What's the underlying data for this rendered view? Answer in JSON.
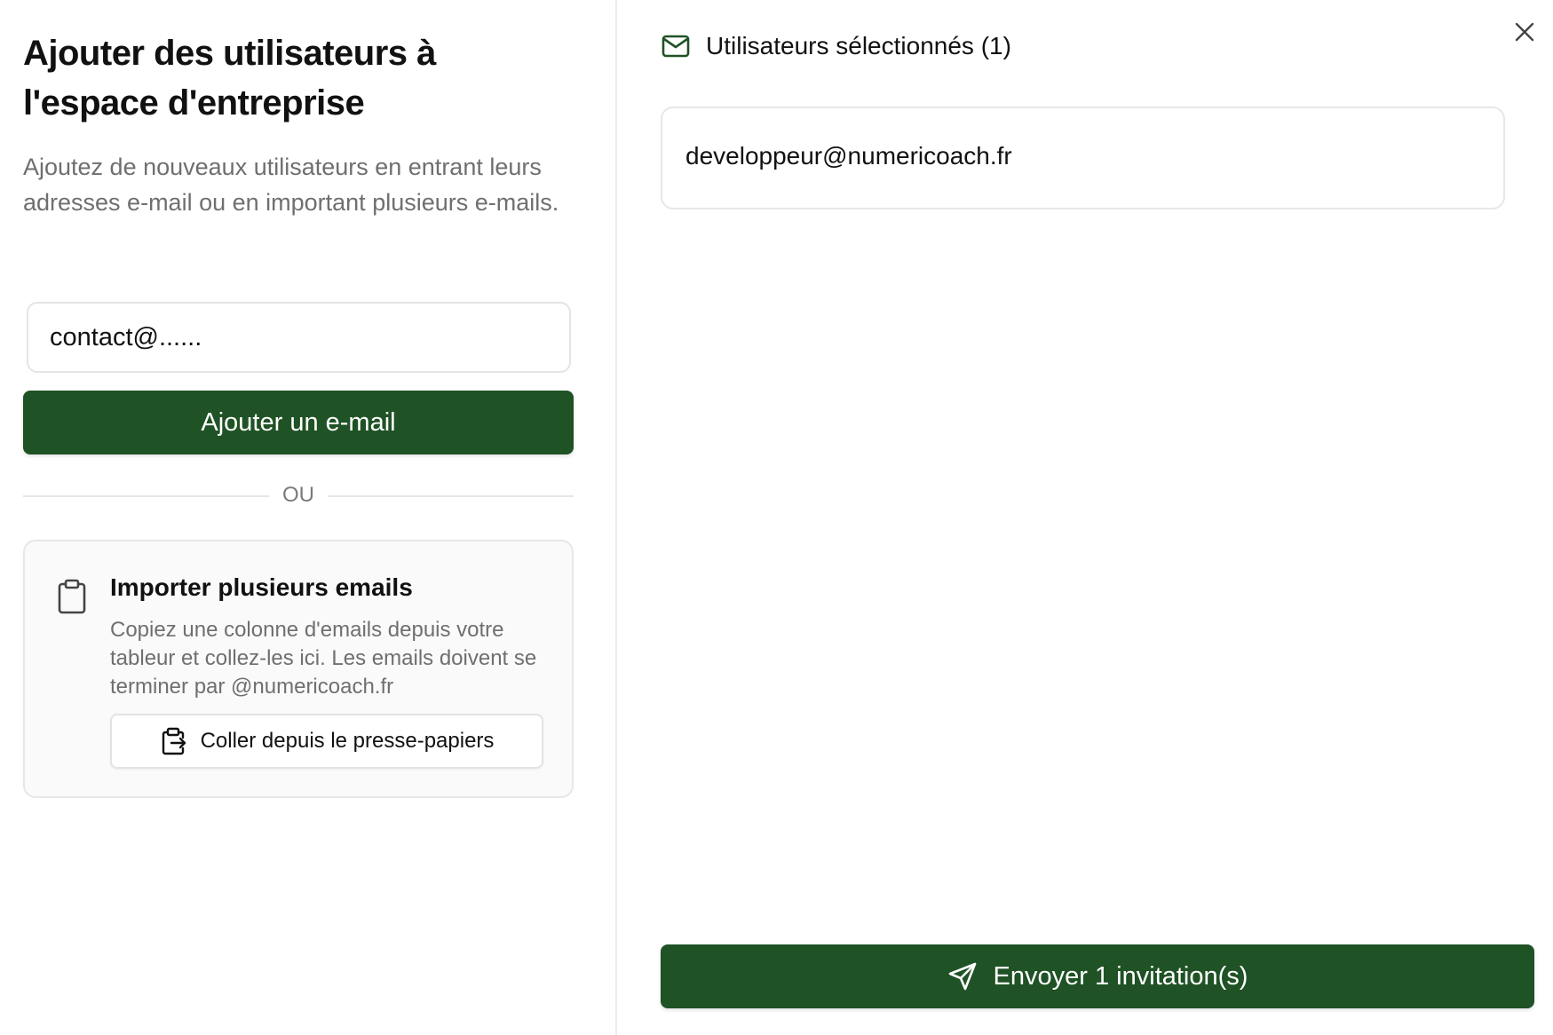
{
  "left_panel": {
    "title": "Ajouter des utilisateurs à l'espace d'entreprise",
    "subtitle": "Ajoutez de nouveaux utilisateurs en entrant leurs adresses e-mail ou en important plusieurs e-mails.",
    "email_input": {
      "value": "contact@......",
      "placeholder": ""
    },
    "add_button_label": "Ajouter un e-mail",
    "divider_label": "OU",
    "import_card": {
      "icon": "clipboard-icon",
      "title": "Importer plusieurs emails",
      "description": "Copiez une colonne d'emails depuis votre tableur et collez-les ici. Les emails doivent se terminer par @numericoach.fr",
      "paste_button": {
        "icon": "clipboard-paste-icon",
        "label": "Coller depuis le presse-papiers"
      }
    }
  },
  "right_panel": {
    "header": {
      "icon": "mail-icon",
      "title": "Utilisateurs sélectionnés (1)"
    },
    "selected_emails": [
      "developpeur@numericoach.fr"
    ],
    "send_button": {
      "icon": "send-icon",
      "label": "Envoyer 1 invitation(s)"
    },
    "close_icon": "close-icon"
  },
  "colors": {
    "primary_green": "#1f5225",
    "muted_text": "#6f6f6f",
    "border": "#e7e7e7"
  }
}
